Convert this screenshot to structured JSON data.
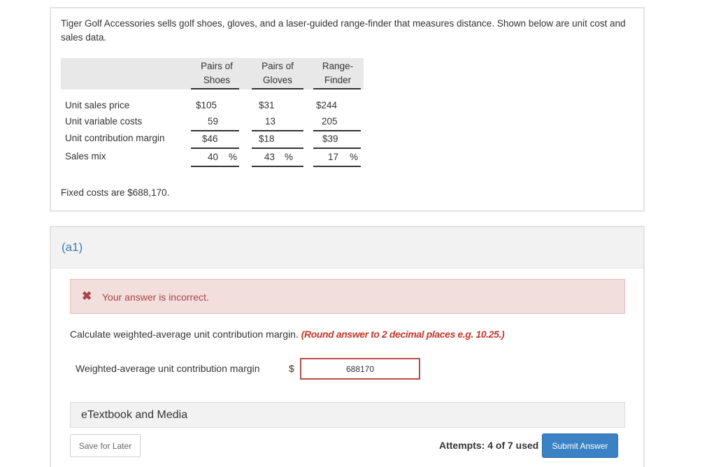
{
  "problem": {
    "intro": "Tiger Golf Accessories sells golf shoes, gloves, and a laser-guided range-finder that measures distance. Shown below are unit cost and sales data.",
    "columns": [
      {
        "line1": "Pairs of",
        "line2": "Shoes"
      },
      {
        "line1": "Pairs of",
        "line2": "Gloves"
      },
      {
        "line1": "Range-",
        "line2": "Finder"
      }
    ],
    "rows": [
      {
        "label": "Unit sales price",
        "values": [
          "$105",
          "$31",
          "$244"
        ]
      },
      {
        "label": "Unit variable costs",
        "values": [
          "59",
          "13",
          "205"
        ]
      },
      {
        "label": "Unit contribution margin",
        "values": [
          "$46",
          "$18",
          "$39"
        ]
      },
      {
        "label": "Sales mix",
        "values": [
          "40",
          "43",
          "17"
        ],
        "unit": "%"
      }
    ],
    "fixed_costs": "Fixed costs are $688,170."
  },
  "part": {
    "label": "(a1)",
    "alert": {
      "icon": "x-icon",
      "text": "Your answer is incorrect.",
      "color": "#a94442"
    },
    "question": "Calculate weighted-average unit contribution margin.",
    "hint": "(Round answer to 2 decimal places e.g. 10.25.)",
    "answer_label": "Weighted-average unit contribution margin",
    "currency": "$",
    "answer_value": "688170",
    "etextbook": "eTextbook and Media",
    "save_label": "Save for Later",
    "attempts": "Attempts: 4 of 7 used",
    "submit_label": "Submit Answer"
  },
  "colors": {
    "accent": "#3b82c4",
    "error": "#a94442",
    "error_bg": "#f3dede"
  }
}
